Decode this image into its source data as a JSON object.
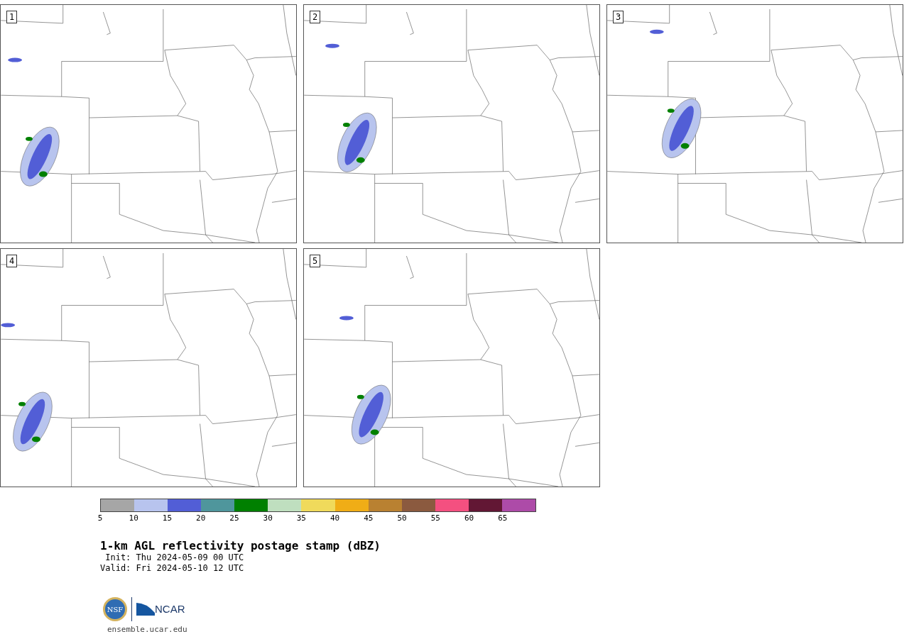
{
  "panels": [
    {
      "label": "1"
    },
    {
      "label": "2"
    },
    {
      "label": "3"
    },
    {
      "label": "4"
    },
    {
      "label": "5"
    }
  ],
  "legend": {
    "bins": [
      {
        "color": "#a6a6a6"
      },
      {
        "color": "#b8c4ee"
      },
      {
        "color": "#525ed6"
      },
      {
        "color": "#4f969c"
      },
      {
        "color": "#008000"
      },
      {
        "color": "#bfdfbf"
      },
      {
        "color": "#f0da5b"
      },
      {
        "color": "#f0ad16"
      },
      {
        "color": "#b98131"
      },
      {
        "color": "#8b5a3f"
      },
      {
        "color": "#f45080"
      },
      {
        "color": "#621734"
      },
      {
        "color": "#ad4ba8"
      }
    ],
    "ticks": [
      "5",
      "10",
      "15",
      "20",
      "25",
      "30",
      "35",
      "40",
      "45",
      "50",
      "55",
      "60",
      "65"
    ]
  },
  "title": "1-km AGL reflectivity postage stamp (dBZ)",
  "init": " Init: Thu 2024-05-09 00 UTC",
  "valid": "Valid: Fri 2024-05-10 12 UTC",
  "logo": {
    "nsf": "NSF",
    "ncar": "NCAR"
  },
  "site": "ensemble.ucar.edu"
}
